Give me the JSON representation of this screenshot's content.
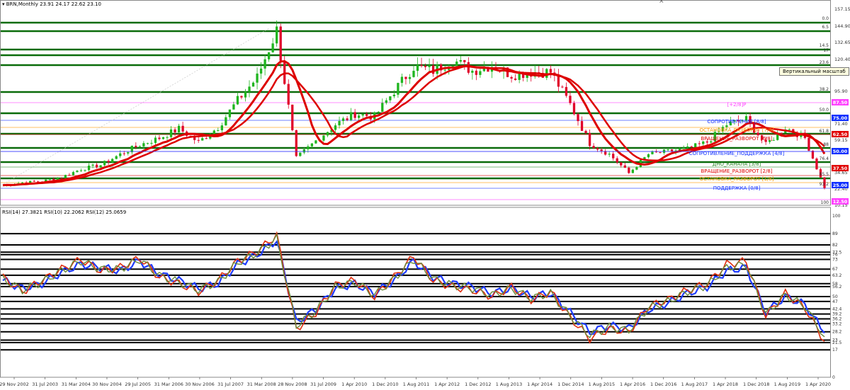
{
  "header": {
    "symbol_line": "BRN,Monthly  23.91 24.17 22.62 23.10",
    "rsi_line": "RSI(14) 27.3821  RSI(10) 22.2062  RSI(12) 25.0659"
  },
  "tooltip": "Вертикальный масштаб",
  "colors": {
    "bg": "#ffffff",
    "level_green": "#0a6b0a",
    "ma": "#dd0000",
    "candle_up": "#1fb51f",
    "candle_down": "#e0002a",
    "rsi14": "#1f3cff",
    "rsi10": "#e03010",
    "rsi12": "#6a8a3a",
    "rsi_band": "#000000",
    "blue_line": "#4040ff"
  },
  "price_axis": {
    "ticks": [
      "157.15",
      "144.90",
      "132.65",
      "120.40",
      "95.90",
      "71.40",
      "59.15",
      "34.65",
      "22.40",
      "10.15"
    ],
    "level_labels": [
      {
        "text": "0.0",
        "color": "#333"
      },
      {
        "text": "6.5",
        "color": "#333"
      },
      {
        "text": "14.5",
        "color": "#333"
      },
      {
        "text": "17",
        "color": "#333"
      },
      {
        "text": "23.6",
        "color": "#333"
      },
      {
        "text": "38.2",
        "color": "#333"
      },
      {
        "text": "50.0",
        "color": "#333"
      },
      {
        "text": "61.8",
        "color": "#333"
      },
      {
        "text": "88",
        "color": "#333"
      },
      {
        "text": "76.4",
        "color": "#333"
      },
      {
        "text": "85.5",
        "color": "#333"
      },
      {
        "text": "93.2",
        "color": "#333"
      },
      {
        "text": "100",
        "color": "#333"
      }
    ],
    "boxes": [
      {
        "text": "87.50",
        "color": "#ff40ff"
      },
      {
        "text": "75.00",
        "color": "#1030ff"
      },
      {
        "text": "62.50",
        "color": "#e00000"
      },
      {
        "text": "50.00",
        "color": "#1030ff"
      },
      {
        "text": "37.50",
        "color": "#e00000"
      },
      {
        "text": "25.00",
        "color": "#1030ff"
      },
      {
        "text": "12.50",
        "color": "#ff40ff"
      }
    ]
  },
  "murrey_labels": [
    {
      "text": "[+2/8]P",
      "color": "#ff40ff"
    },
    {
      "text": "СОПРОТИВЛЕНИЕ [8/8]",
      "color": "#1030ff"
    },
    {
      "text": "ОСТАНОВКА_РАЗВОРОТ [7/8]",
      "color": "#ff9900"
    },
    {
      "text": "ВРАЩЕНИЕ_РАЗВОРОТ [6/8]",
      "color": "#e00000"
    },
    {
      "text": "СОПРОТИВЛЕНИЕ_ПОДДЕРЖКА [4/8]",
      "color": "#1030ff"
    },
    {
      "text": "ДНО_КАНАЛА [3/8]",
      "color": "#2a8a2a"
    },
    {
      "text": "ВРАЩЕНИЕ_РАЗВОРОТ [2/8]",
      "color": "#e00000"
    },
    {
      "text": "ОСТАНОВКА_РАЗВОРОТ [1/8]",
      "color": "#ff9900"
    },
    {
      "text": "ПОДДЕРЖКА [0/8]",
      "color": "#1030ff"
    }
  ],
  "rsi_axis": {
    "ticks": [
      "100",
      "89",
      "82",
      "77.5",
      "76",
      "73",
      "67",
      "63.2",
      "58",
      "56.2",
      "50",
      "47",
      "42.4",
      "39.2",
      "36.2",
      "33.2",
      "28.2",
      "23",
      "21.5",
      "17",
      "0"
    ]
  },
  "time_axis": {
    "labels": [
      "29 Nov 2002",
      "31 Jul 2003",
      "31 Mar 2004",
      "30 Nov 2004",
      "29 Jul 2005",
      "31 Mar 2006",
      "30 Nov 2006",
      "31 Jul 2007",
      "31 Mar 2008",
      "28 Nov 2008",
      "31 Jul 2009",
      "1 Apr 2010",
      "1 Dec 2010",
      "1 Aug 2011",
      "1 Apr 2012",
      "1 Dec 2012",
      "1 Aug 2013",
      "1 Apr 2014",
      "1 Dec 2014",
      "1 Aug 2015",
      "1 Apr 2016",
      "1 Dec 2016",
      "1 Aug 2017",
      "1 Apr 2018",
      "1 Dec 2018",
      "1 Aug 2019",
      "1 Apr 2020"
    ]
  },
  "chart_data": [
    {
      "type": "line",
      "title": "BRN,Monthly",
      "x": [
        "2002-11",
        "2003-04",
        "2003-09",
        "2004-02",
        "2004-07",
        "2004-12",
        "2005-05",
        "2005-10",
        "2006-03",
        "2006-08",
        "2007-01",
        "2007-06",
        "2007-11",
        "2008-03",
        "2008-07",
        "2008-12",
        "2009-05",
        "2009-10",
        "2010-03",
        "2010-08",
        "2011-01",
        "2011-06",
        "2011-11",
        "2012-04",
        "2012-09",
        "2013-02",
        "2013-07",
        "2013-12",
        "2014-05",
        "2014-10",
        "2015-03",
        "2015-08",
        "2016-01",
        "2016-06",
        "2016-11",
        "2017-04",
        "2017-09",
        "2018-02",
        "2018-07",
        "2018-12",
        "2019-05",
        "2019-10",
        "2020-03"
      ],
      "series": [
        {
          "values": [
            25,
            27,
            28,
            31,
            37,
            40,
            48,
            55,
            60,
            67,
            57,
            68,
            88,
            105,
            140,
            45,
            58,
            70,
            78,
            76,
            95,
            113,
            110,
            118,
            110,
            114,
            107,
            109,
            109,
            85,
            56,
            48,
            34,
            48,
            50,
            52,
            57,
            70,
            74,
            55,
            68,
            60,
            23
          ]
        }
      ],
      "murrey_levels": [
        87.5,
        75.0,
        62.5,
        50.0,
        37.5,
        25.0,
        12.5
      ],
      "ylim": [
        10.15,
        157.15
      ]
    },
    {
      "type": "line",
      "title": "RSI(14) 27.3821  RSI(10) 22.2062  RSI(12) 25.0659",
      "x": [
        "2002-11",
        "2003-04",
        "2003-09",
        "2004-02",
        "2004-07",
        "2004-12",
        "2005-05",
        "2005-10",
        "2006-03",
        "2006-08",
        "2007-01",
        "2007-06",
        "2007-11",
        "2008-03",
        "2008-07",
        "2008-12",
        "2009-05",
        "2009-10",
        "2010-03",
        "2010-08",
        "2011-01",
        "2011-06",
        "2011-11",
        "2012-04",
        "2012-09",
        "2013-02",
        "2013-07",
        "2013-12",
        "2014-05",
        "2014-10",
        "2015-03",
        "2015-08",
        "2016-01",
        "2016-06",
        "2016-11",
        "2017-04",
        "2017-09",
        "2018-02",
        "2018-07",
        "2018-12",
        "2019-05",
        "2019-10",
        "2020-03"
      ],
      "series": [
        {
          "name": "RSI(14)",
          "values": [
            60,
            55,
            58,
            65,
            70,
            68,
            66,
            72,
            64,
            60,
            55,
            58,
            70,
            76,
            85,
            34,
            42,
            55,
            58,
            52,
            60,
            72,
            62,
            58,
            56,
            52,
            55,
            50,
            52,
            40,
            28,
            32,
            30,
            42,
            46,
            52,
            56,
            66,
            68,
            40,
            50,
            45,
            27.4
          ]
        },
        {
          "name": "RSI(10)",
          "values": [
            62,
            53,
            60,
            67,
            73,
            66,
            68,
            74,
            62,
            58,
            53,
            60,
            72,
            78,
            88,
            30,
            40,
            57,
            60,
            50,
            62,
            75,
            60,
            56,
            54,
            50,
            56,
            48,
            53,
            37,
            24,
            30,
            28,
            44,
            48,
            54,
            58,
            70,
            72,
            38,
            52,
            43,
            22.2
          ]
        },
        {
          "name": "RSI(12)",
          "values": [
            61,
            54,
            59,
            66,
            72,
            67,
            67,
            73,
            63,
            59,
            54,
            59,
            71,
            77,
            86,
            32,
            41,
            56,
            59,
            51,
            61,
            73,
            61,
            57,
            55,
            51,
            55,
            49,
            52,
            38,
            26,
            31,
            29,
            43,
            47,
            53,
            57,
            68,
            70,
            39,
            51,
            44,
            25.1
          ]
        }
      ],
      "levels": [
        89,
        82,
        77.5,
        76,
        73,
        67,
        63.2,
        58,
        56.2,
        50,
        47,
        42.4,
        39.2,
        36.2,
        33.2,
        28.2,
        23,
        21.5,
        17
      ],
      "ylim": [
        0,
        100
      ]
    }
  ]
}
